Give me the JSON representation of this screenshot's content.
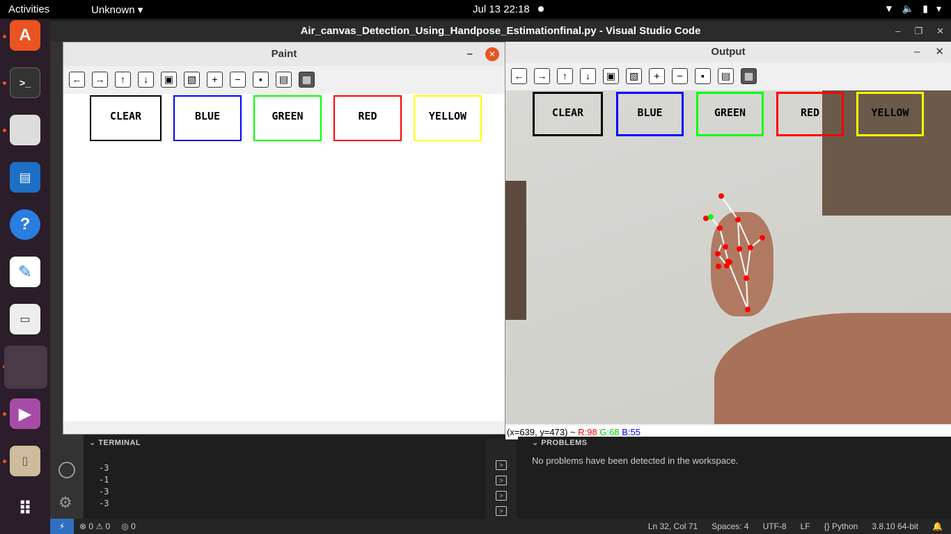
{
  "topbar": {
    "activities": "Activities",
    "app_menu": "Unknown",
    "clock": "Jul 13  22:18"
  },
  "vscode": {
    "title": "Air_canvas_Detection_Using_Handpose_Estimationfinal.py - Visual Studio Code"
  },
  "paint": {
    "title": "Paint",
    "buttons": [
      "CLEAR",
      "BLUE",
      "GREEN",
      "RED",
      "YELLOW"
    ]
  },
  "output": {
    "title": "Output",
    "buttons": [
      "CLEAR",
      "BLUE",
      "GREEN",
      "RED",
      "YELLOW"
    ],
    "status_coords": "(x=639, y=473) ~",
    "status_r": "R:98",
    "status_g": "G:68",
    "status_b": "B:55"
  },
  "terminal": {
    "header": "TERMINAL",
    "lines": [
      "-3",
      "-1",
      "-3",
      "-3"
    ]
  },
  "problems": {
    "header": "PROBLEMS",
    "message": "No problems have been detected in the workspace."
  },
  "statusbar": {
    "errors": "0",
    "warnings": "0",
    "ports": "0",
    "position": "Ln 32, Col 71",
    "spaces": "Spaces: 4",
    "encoding": "UTF-8",
    "eol": "LF",
    "language": "Python",
    "interpreter": "3.8.10 64-bit"
  },
  "colors": {
    "clear": "#000000",
    "blue": "#0000ff",
    "green": "#00ff00",
    "red": "#ff0000",
    "yellow": "#ffff00",
    "ubuntu_orange": "#e95420"
  },
  "dock_icons": [
    "ubuntu-software-icon",
    "terminal-icon",
    "files-icon",
    "writer-icon",
    "help-icon",
    "text-editor-icon",
    "document-viewer-icon",
    "active-app-icon",
    "media-player-icon",
    "archive-icon",
    "show-apps-icon"
  ]
}
